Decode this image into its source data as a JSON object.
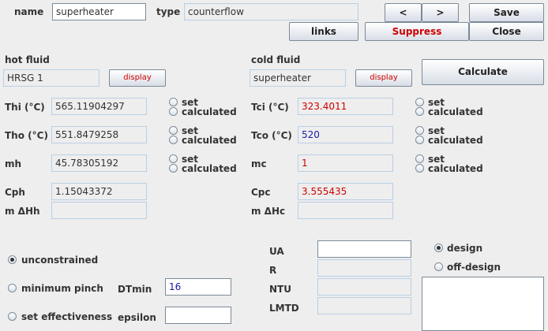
{
  "header": {
    "name_label": "name",
    "name_value": "superheater",
    "type_label": "type",
    "type_value": "counterflow",
    "prev_label": "<",
    "next_label": ">",
    "save_label": "Save",
    "links_label": "links",
    "suppress_label": "Suppress",
    "close_label": "Close"
  },
  "hot": {
    "title": "hot fluid",
    "fluid": "HRSG 1",
    "display_label": "display",
    "thi_label": "Thi (°C)",
    "thi_value": "565.11904297",
    "tho_label": "Tho (°C)",
    "tho_value": "551.8479258",
    "mh_label": "mh",
    "mh_value": "45.78305192",
    "cph_label": "Cph",
    "cph_value": "1.15043372",
    "dh_label": "m ΔHh",
    "dh_value": ""
  },
  "cold": {
    "title": "cold fluid",
    "fluid": "superheater",
    "display_label": "display",
    "tci_label": "Tci (°C)",
    "tci_value": "323.4011",
    "tco_label": "Tco (°C)",
    "tco_value": "520",
    "mc_label": "mc",
    "mc_value": "1",
    "cpc_label": "Cpc",
    "cpc_value": "3.555435",
    "dh_label": "m ΔHc",
    "dh_value": ""
  },
  "radio_labels": {
    "set": "set",
    "calculated": "calculated"
  },
  "calculate_label": "Calculate",
  "constraints": {
    "unconstrained": "unconstrained",
    "minimum_pinch": "minimum pinch",
    "set_effectiveness": "set effectiveness",
    "dtmin_label": "DTmin",
    "dtmin_value": "16",
    "epsilon_label": "epsilon",
    "epsilon_value": ""
  },
  "results": {
    "ua_label": "UA",
    "ua_value": "",
    "r_label": "R",
    "r_value": "",
    "ntu_label": "NTU",
    "ntu_value": "",
    "lmtd_label": "LMTD",
    "lmtd_value": ""
  },
  "mode": {
    "design": "design",
    "off_design": "off-design"
  }
}
